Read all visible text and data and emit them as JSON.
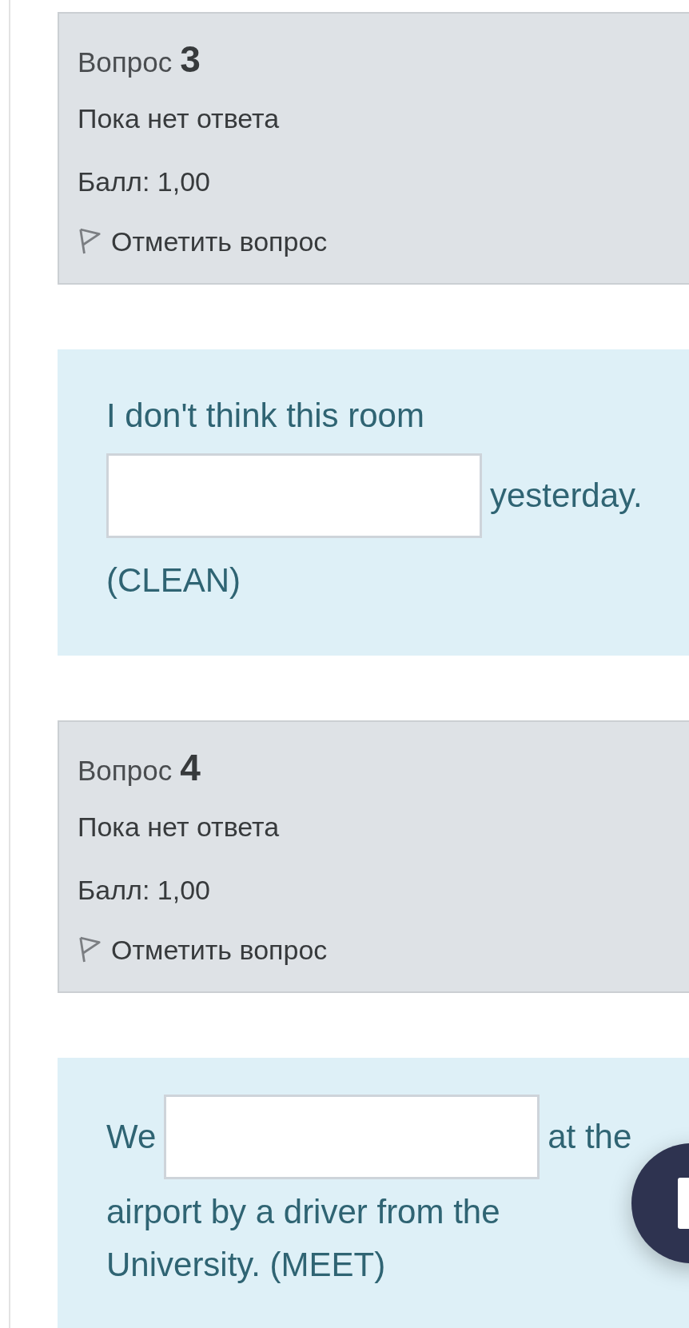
{
  "questions": [
    {
      "label": "Вопрос",
      "number": "3",
      "status": "Пока нет ответа",
      "grade": "Балл: 1,00",
      "flag_label": "Отметить вопрос",
      "parts": [
        {
          "kind": "text",
          "text": "I don't think this room"
        },
        {
          "kind": "blank"
        },
        {
          "kind": "text",
          "text": "yesterday."
        },
        {
          "kind": "text",
          "text": "(CLEAN)"
        }
      ]
    },
    {
      "label": "Вопрос",
      "number": "4",
      "status": "Пока нет ответа",
      "grade": "Балл: 1,00",
      "flag_label": "Отметить вопрос",
      "parts": [
        {
          "kind": "text",
          "text": "We"
        },
        {
          "kind": "blank"
        },
        {
          "kind": "text",
          "text": "at the"
        },
        {
          "kind": "text",
          "text": "airport by a driver from the University. (MEET)"
        }
      ]
    }
  ]
}
